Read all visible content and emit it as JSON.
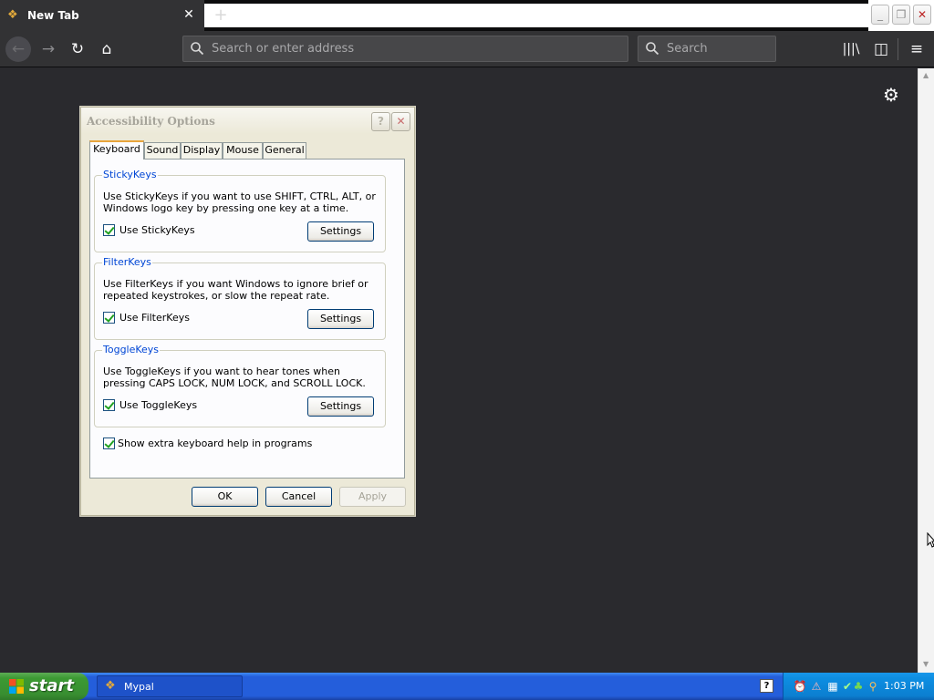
{
  "browser": {
    "tab": {
      "title": "New Tab",
      "close_glyph": "✕",
      "icon": "mypal-logo-icon"
    },
    "new_tab_glyph": "+",
    "window_controls": {
      "minimize": "_",
      "restore": "❐",
      "close": "✕"
    },
    "nav": {
      "back_glyph": "←",
      "forward_glyph": "→",
      "reload_glyph": "↻",
      "home_glyph": "⌂",
      "library_glyph": "|||\\",
      "sidebar_glyph": "◫",
      "menu_glyph": "≡"
    },
    "urlbar": {
      "placeholder": "Search or enter address",
      "value": ""
    },
    "searchbar": {
      "placeholder": "Search",
      "value": ""
    },
    "content_gear_glyph": "⚙"
  },
  "dialog": {
    "title": "Accessibility Options",
    "help_glyph": "?",
    "close_glyph": "✕",
    "tabs": [
      {
        "label": "Keyboard",
        "active": true
      },
      {
        "label": "Sound"
      },
      {
        "label": "Display"
      },
      {
        "label": "Mouse"
      },
      {
        "label": "General"
      }
    ],
    "groups": [
      {
        "title": "StickyKeys",
        "description": "Use StickyKeys if you want to use SHIFT, CTRL, ALT, or Windows logo key by pressing one key at a time.",
        "checkbox_label": "Use StickyKeys",
        "checked": true,
        "button_label": "Settings"
      },
      {
        "title": "FilterKeys",
        "description": "Use FilterKeys if you want Windows to ignore brief or repeated keystrokes, or slow the repeat rate.",
        "checkbox_label": "Use FilterKeys",
        "checked": true,
        "button_label": "Settings"
      },
      {
        "title": "ToggleKeys",
        "description": "Use ToggleKeys if you want to hear tones when pressing CAPS LOCK, NUM LOCK, and SCROLL LOCK.",
        "checkbox_label": "Use ToggleKeys",
        "checked": true,
        "button_label": "Settings"
      }
    ],
    "extra_help": {
      "label": "Show extra keyboard help in programs",
      "checked": true
    },
    "buttons": {
      "ok": "OK",
      "cancel": "Cancel",
      "apply": "Apply",
      "apply_disabled": true
    }
  },
  "taskbar": {
    "start_label": "start",
    "tasks": [
      {
        "label": "Mypal",
        "icon": "mypal-logo-icon"
      }
    ],
    "help_glyph": "?",
    "tray": {
      "icons": [
        "alarm-clock-icon",
        "warning-icon",
        "network-icon",
        "shield-icon",
        "security-icon",
        "search-icon"
      ],
      "glyphs": {
        "clock": "⏰",
        "warn": "⚠",
        "network": "▦",
        "shield": "✔",
        "security": "♣",
        "search": "⚲"
      },
      "time": "1:03 PM"
    }
  },
  "colors": {
    "browser_dark": "#323234",
    "content_bg": "#2a2a2e",
    "dialog_bg": "#ece9d8",
    "group_title": "#0046d5",
    "taskbar_blue": "#245edb",
    "start_green": "#3c9a33"
  }
}
